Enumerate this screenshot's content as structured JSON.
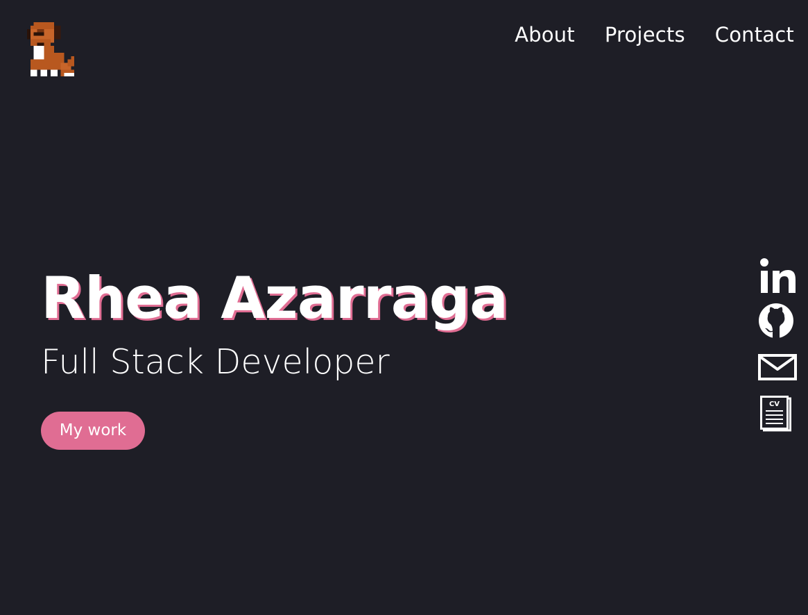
{
  "brand": {
    "logo_icon": "pixel-dog-icon",
    "logo_alt": ""
  },
  "nav": {
    "items": [
      {
        "label": "About"
      },
      {
        "label": "Projects"
      },
      {
        "label": "Contact"
      }
    ]
  },
  "hero": {
    "name": "Rhea Azarraga",
    "role": "Full Stack Developer",
    "cta_label": "My work"
  },
  "socials": {
    "items": [
      {
        "icon": "linkedin-icon"
      },
      {
        "icon": "github-icon"
      },
      {
        "icon": "mail-icon"
      },
      {
        "icon": "cv-document-icon",
        "label": "CV"
      }
    ]
  },
  "colors": {
    "background": "#1e1e26",
    "accent": "#e06d93",
    "text": "#ffffff",
    "dog_brown": "#b8581f",
    "dog_dark": "#2a1208"
  }
}
